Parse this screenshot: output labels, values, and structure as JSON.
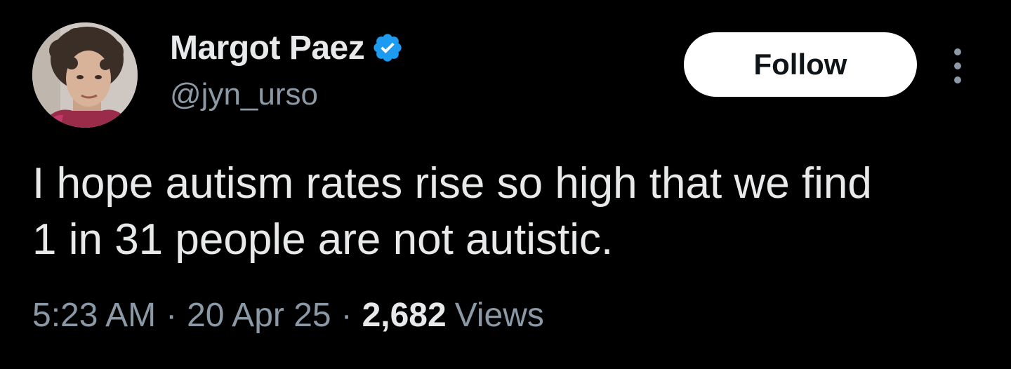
{
  "author": {
    "display_name": "Margot Paez",
    "handle": "@jyn_urso",
    "verified": true,
    "avatar_icon": "profile-photo"
  },
  "actions": {
    "follow_label": "Follow",
    "more_icon": "more-vertical-icon"
  },
  "tweet": {
    "text": "I hope autism rates rise so high that we find\n1 in 31 people are not autistic."
  },
  "meta": {
    "time": "5:23 AM",
    "separator": "·",
    "date": "20 Apr 25",
    "views_count": "2,682",
    "views_label": "Views"
  },
  "colors": {
    "background": "#000000",
    "primary_text": "#e7e9ea",
    "secondary_text": "#8b98a5",
    "verified_badge": "#1d9bf0",
    "follow_button_bg": "#ffffff",
    "follow_button_text": "#0f1419"
  }
}
